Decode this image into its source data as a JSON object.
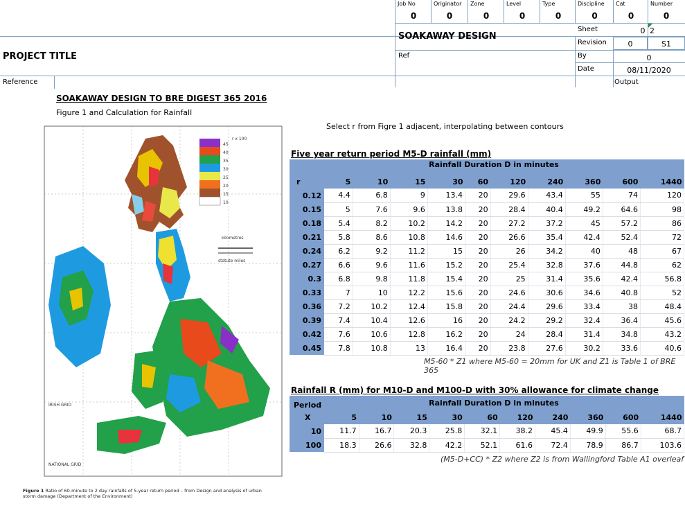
{
  "header": {
    "fields": [
      {
        "label": "Job No",
        "value": "0"
      },
      {
        "label": "Originator",
        "value": "0"
      },
      {
        "label": "Zone",
        "value": "0"
      },
      {
        "label": "Level",
        "value": "0"
      },
      {
        "label": "Type",
        "value": "0"
      },
      {
        "label": "Discipline",
        "value": "0"
      },
      {
        "label": "Cat",
        "value": "0"
      },
      {
        "label": "Number",
        "value": "0"
      }
    ],
    "doc_title": "SOAKAWAY DESIGN",
    "project_title": "PROJECT TITLE",
    "ref_label": "Ref",
    "reference_label": "Reference",
    "output_label": "Output",
    "sheet_label": "Sheet",
    "sheet_a": "0",
    "sheet_b": "2",
    "revision_label": "Revision",
    "revision_a": "0",
    "revision_b": "S1",
    "by_label": "By",
    "by_value": "0",
    "date_label": "Date",
    "date_value": "08/11/2020"
  },
  "body": {
    "main_title": "SOAKAWAY DESIGN TO BRE DIGEST 365 2016",
    "subtitle": "Figure 1  and Calculation for Rainfall",
    "instruction": "Select r from Figre 1 adjacent, interpolating between contours",
    "figure_caption_bold": "Figure 1",
    "figure_caption": " Ratio of 60-minute to 2 day rainfalls of 5-year return period – from Design and analysis of urban storm damage (Department of the Environment)",
    "map_labels": {
      "scale": "r x 100",
      "km": "kilometres",
      "miles": "statute miles",
      "irish_grid": "IRISH GRID",
      "national_grid": "NATIONAL GRID"
    },
    "legend": [
      "45",
      "40",
      "35",
      "30",
      "25",
      "20",
      "15",
      "10"
    ]
  },
  "table1": {
    "title": "Five year return period M5-D rainfall (mm)",
    "span_label": "Rainfall Duration D in minutes",
    "r_label": "r",
    "durations": [
      "5",
      "10",
      "15",
      "30",
      "60",
      "120",
      "240",
      "360",
      "600",
      "1440"
    ],
    "rows": [
      {
        "r": "0.12",
        "v": [
          "4.4",
          "6.8",
          "9",
          "13.4",
          "20",
          "29.6",
          "43.4",
          "55",
          "74",
          "120"
        ]
      },
      {
        "r": "0.15",
        "v": [
          "5",
          "7.6",
          "9.6",
          "13.8",
          "20",
          "28.4",
          "40.4",
          "49.2",
          "64.6",
          "98"
        ]
      },
      {
        "r": "0.18",
        "v": [
          "5.4",
          "8.2",
          "10.2",
          "14.2",
          "20",
          "27.2",
          "37.2",
          "45",
          "57.2",
          "86"
        ]
      },
      {
        "r": "0.21",
        "v": [
          "5.8",
          "8.6",
          "10.8",
          "14.6",
          "20",
          "26.6",
          "35.4",
          "42.4",
          "52.4",
          "72"
        ]
      },
      {
        "r": "0.24",
        "v": [
          "6.2",
          "9.2",
          "11.2",
          "15",
          "20",
          "26",
          "34.2",
          "40",
          "48",
          "67"
        ]
      },
      {
        "r": "0.27",
        "v": [
          "6.6",
          "9.6",
          "11.6",
          "15.2",
          "20",
          "25.4",
          "32.8",
          "37.6",
          "44.8",
          "62"
        ]
      },
      {
        "r": "0.3",
        "v": [
          "6.8",
          "9.8",
          "11.8",
          "15.4",
          "20",
          "25",
          "31.4",
          "35.6",
          "42.4",
          "56.8"
        ]
      },
      {
        "r": "0.33",
        "v": [
          "7",
          "10",
          "12.2",
          "15.6",
          "20",
          "24.6",
          "30.6",
          "34.6",
          "40.8",
          "52"
        ]
      },
      {
        "r": "0.36",
        "v": [
          "7.2",
          "10.2",
          "12.4",
          "15.8",
          "20",
          "24.4",
          "29.6",
          "33.4",
          "38",
          "48.4"
        ]
      },
      {
        "r": "0.39",
        "v": [
          "7.4",
          "10.4",
          "12.6",
          "16",
          "20",
          "24.2",
          "29.2",
          "32.4",
          "36.4",
          "45.6"
        ]
      },
      {
        "r": "0.42",
        "v": [
          "7.6",
          "10.6",
          "12.8",
          "16.2",
          "20",
          "24",
          "28.4",
          "31.4",
          "34.8",
          "43.2"
        ]
      },
      {
        "r": "0.45",
        "v": [
          "7.8",
          "10.8",
          "13",
          "16.4",
          "20",
          "23.8",
          "27.6",
          "30.2",
          "33.6",
          "40.6"
        ]
      }
    ],
    "note": "M5-60 * Z1 where M5-60 = 20mm for UK and Z1 is Table 1 of BRE 365"
  },
  "table2": {
    "title": "Rainfall R (mm) for M10-D and M100-D with 30% allowance for climate change",
    "period_label": "Period",
    "x_label": "X",
    "span_label": "Rainfall Duration D in minutes",
    "durations": [
      "5",
      "10",
      "15",
      "30",
      "60",
      "120",
      "240",
      "360",
      "600",
      "1440"
    ],
    "rows": [
      {
        "p": "10",
        "v": [
          "11.7",
          "16.7",
          "20.3",
          "25.8",
          "32.1",
          "38.2",
          "45.4",
          "49.9",
          "55.6",
          "68.7"
        ]
      },
      {
        "p": "100",
        "v": [
          "18.3",
          "26.6",
          "32.8",
          "42.2",
          "52.1",
          "61.6",
          "72.4",
          "78.9",
          "86.7",
          "103.6"
        ]
      }
    ],
    "note": "(M5-D+CC) * Z2 where Z2 is from Wallingford Table A1 overleaf"
  }
}
